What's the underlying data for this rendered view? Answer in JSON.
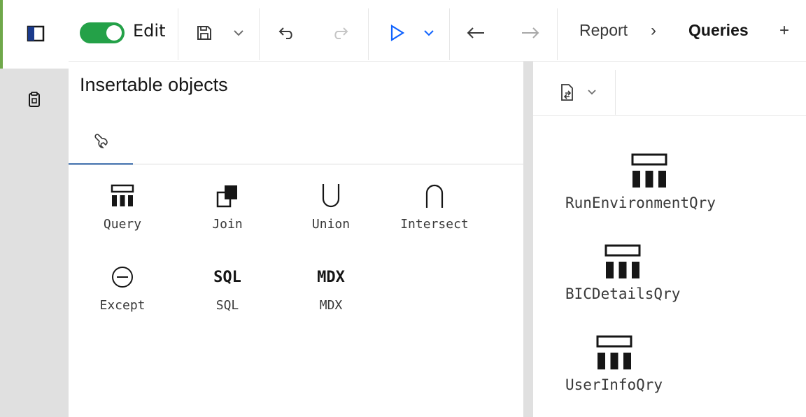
{
  "toolbar": {
    "edit_label": "Edit",
    "edit_enabled": true,
    "breadcrumb": [
      "Report",
      "Queries"
    ],
    "add_label": "+",
    "breadcrumb_separator": "›"
  },
  "panel": {
    "title": "Insertable objects",
    "tab_icon": "wrench-icon",
    "objects": [
      {
        "label": "Query",
        "icon": "query-icon"
      },
      {
        "label": "Join",
        "icon": "join-icon"
      },
      {
        "label": "Union",
        "icon": "union-icon",
        "glyph": "⋃"
      },
      {
        "label": "Intersect",
        "icon": "intersect-icon",
        "glyph": "⋂"
      },
      {
        "label": "Except",
        "icon": "except-icon",
        "glyph": "⊖"
      },
      {
        "label": "SQL",
        "icon": "sql-icon",
        "glyph": "SQL"
      },
      {
        "label": "MDX",
        "icon": "mdx-icon",
        "glyph": "MDX"
      }
    ]
  },
  "queries": [
    {
      "label": "RunEnvironmentQry"
    },
    {
      "label": "BICDetailsQry"
    },
    {
      "label": "UserInfoQry"
    }
  ],
  "colors": {
    "toggle_on": "#24a148",
    "tab_underline": "#3d70b2",
    "run_blue": "#0f62fe",
    "rail_accent": "#6fa84a"
  }
}
